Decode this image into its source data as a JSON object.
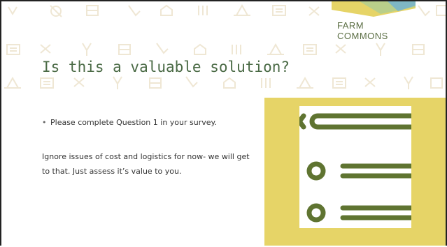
{
  "logo": {
    "text": "FARM COMMONS"
  },
  "slide": {
    "title": "Is this a valuable solution?",
    "bullet_marker": "•",
    "bullet_text": "Please complete Question 1 in your survey.",
    "paragraph": "Ignore issues of cost and logistics for now- we will get to that. Just assess it’s value to you."
  },
  "colors": {
    "title_green": "#4a6a45",
    "panel_yellow": "#e6d467",
    "checklist_green": "#5f7431",
    "logo_green": "#5c6f45",
    "pattern_tan": "#efe7d4"
  },
  "icons": {
    "header_pattern": "farm-pattern-icons",
    "logo_mark": "landscape-logo-icon",
    "panel_graphic": "checklist-icon"
  }
}
